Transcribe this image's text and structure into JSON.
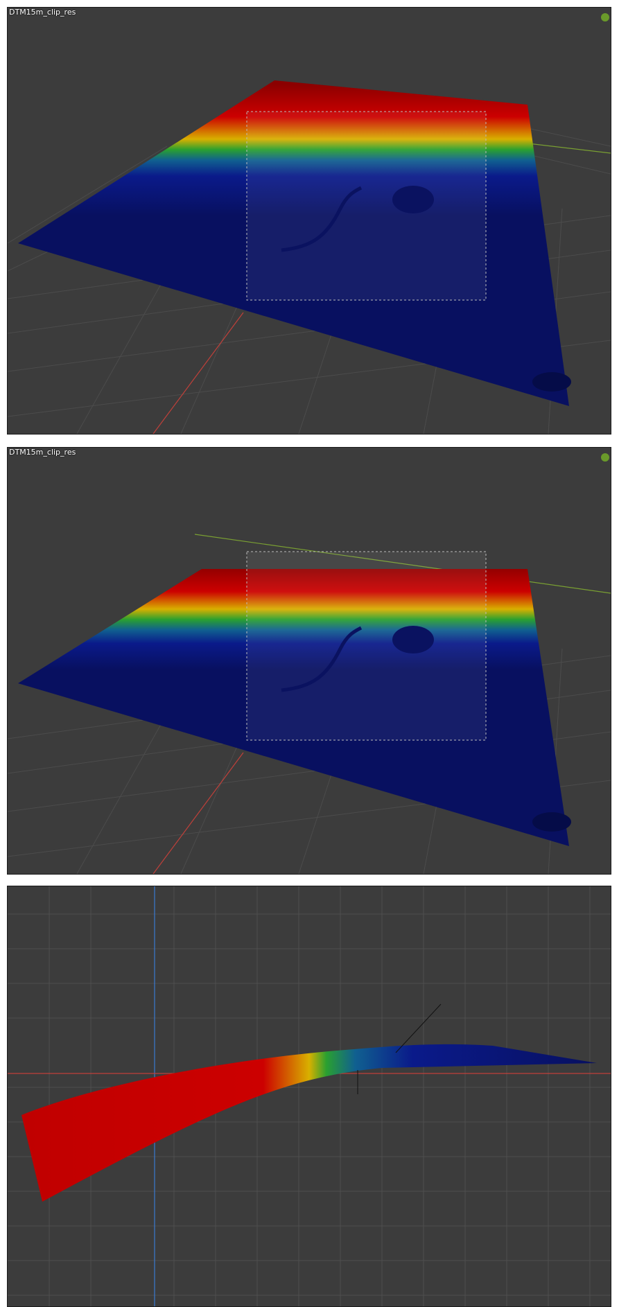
{
  "viewports": [
    {
      "object_name": "DTM15m_clip_res"
    },
    {
      "object_name": "DTM15m_clip_res"
    },
    {
      "object_name": ""
    }
  ],
  "colors": {
    "background": "#3c3c3c",
    "grid": "#4a4a4a",
    "axis_x": "#c0403a",
    "axis_y": "#7aa032",
    "axis_z": "#3a7ad0",
    "ramp": [
      "#8b0000",
      "#cc0000",
      "#e0c000",
      "#20a030",
      "#1060a0",
      "#0a1a8a",
      "#081060"
    ],
    "gizmo": "#6a9a2a"
  },
  "icons": [
    "gizmo-dot-icon"
  ]
}
